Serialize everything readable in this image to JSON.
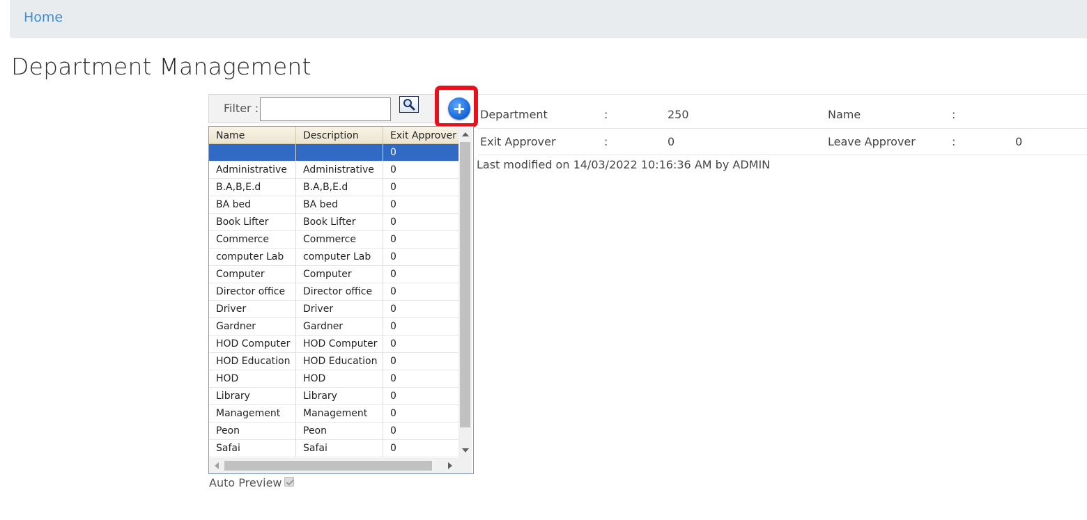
{
  "breadcrumb": {
    "home": "Home"
  },
  "page_title": "Department Management",
  "filter": {
    "label": "Filter :",
    "value": ""
  },
  "grid": {
    "columns": [
      "Name",
      "Description",
      "Exit Approver"
    ],
    "rows": [
      {
        "name": "",
        "description": "",
        "exit_approver": "0",
        "selected": true
      },
      {
        "name": "Administrative",
        "description": "Administrative",
        "exit_approver": "0"
      },
      {
        "name": "B.A,B,E.d",
        "description": "B.A,B,E.d",
        "exit_approver": "0"
      },
      {
        "name": "BA bed",
        "description": "BA bed",
        "exit_approver": "0"
      },
      {
        "name": "Book Lifter",
        "description": "Book Lifter",
        "exit_approver": "0"
      },
      {
        "name": "Commerce",
        "description": "Commerce",
        "exit_approver": "0"
      },
      {
        "name": "computer Lab",
        "description": "computer Lab",
        "exit_approver": "0"
      },
      {
        "name": "Computer",
        "description": "Computer",
        "exit_approver": "0"
      },
      {
        "name": "Director office",
        "description": "Director office",
        "exit_approver": "0"
      },
      {
        "name": "Driver",
        "description": "Driver",
        "exit_approver": "0"
      },
      {
        "name": "Gardner",
        "description": "Gardner",
        "exit_approver": "0"
      },
      {
        "name": "HOD Computer",
        "description": "HOD Computer",
        "exit_approver": "0"
      },
      {
        "name": "HOD Education",
        "description": "HOD Education",
        "exit_approver": "0"
      },
      {
        "name": "HOD",
        "description": "HOD",
        "exit_approver": "0"
      },
      {
        "name": "Library",
        "description": "Library",
        "exit_approver": "0"
      },
      {
        "name": "Management",
        "description": "Management",
        "exit_approver": "0"
      },
      {
        "name": "Peon",
        "description": "Peon",
        "exit_approver": "0"
      },
      {
        "name": "Safai",
        "description": "Safai",
        "exit_approver": "0"
      }
    ]
  },
  "auto_preview": {
    "label": "Auto Preview",
    "checked": true
  },
  "details": {
    "department_label": "Department",
    "department_value": "250",
    "name_label": "Name",
    "name_value": "",
    "exit_approver_label": "Exit Approver",
    "exit_approver_value": "0",
    "leave_approver_label": "Leave Approver",
    "leave_approver_value": "0",
    "separator": ":",
    "last_modified": "Last modified on 14/03/2022 10:16:36 AM by ADMIN"
  },
  "colors": {
    "selection": "#316ac5",
    "highlight_box": "#e8101b",
    "link": "#3b8ed8",
    "breadcrumb_bg": "#e9ecef"
  }
}
